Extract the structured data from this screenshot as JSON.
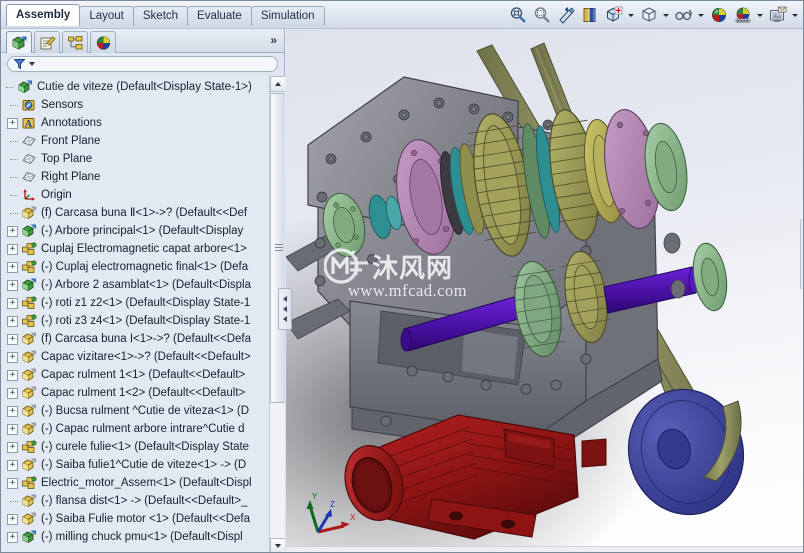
{
  "app": {
    "title": "SolidWorks Assembly",
    "accent": "#2c5d9b"
  },
  "command_manager": {
    "tabs": [
      {
        "label": "Assembly",
        "active": true
      },
      {
        "label": "Layout",
        "active": false
      },
      {
        "label": "Sketch",
        "active": false
      },
      {
        "label": "Evaluate",
        "active": false
      },
      {
        "label": "Simulation",
        "active": false
      }
    ],
    "tools": [
      {
        "name": "zoom-to-fit-icon",
        "dropdown": false
      },
      {
        "name": "zoom-to-area-icon",
        "dropdown": false
      },
      {
        "name": "previous-view-icon",
        "dropdown": false
      },
      {
        "name": "section-view-icon",
        "dropdown": false
      },
      {
        "name": "view-orientation-icon",
        "dropdown": true
      },
      {
        "name": "display-style-icon",
        "dropdown": true
      },
      {
        "name": "hide-show-items-icon",
        "dropdown": true
      },
      {
        "name": "edit-appearance-icon",
        "dropdown": false
      },
      {
        "name": "apply-scene-icon",
        "dropdown": true
      },
      {
        "name": "view-settings-icon",
        "dropdown": true
      }
    ]
  },
  "feature_manager": {
    "tabs": [
      {
        "name": "feature-tree-tab",
        "active": true
      },
      {
        "name": "property-manager-tab",
        "active": false
      },
      {
        "name": "configuration-manager-tab",
        "active": false
      },
      {
        "name": "display-manager-tab",
        "active": false
      }
    ],
    "overflow_label": "»",
    "filter": {
      "placeholder": "",
      "value": "",
      "icon": "filter-icon"
    },
    "tree": [
      {
        "label": "Cutie de viteze  (Default<Display State-1>)",
        "icon": "assembly-icon",
        "depth": 0,
        "expander": "none",
        "root": true
      },
      {
        "label": "Sensors",
        "icon": "sensors-folder-icon",
        "depth": 1,
        "expander": "none"
      },
      {
        "label": "Annotations",
        "icon": "annotations-folder-icon",
        "depth": 1,
        "expander": "plus"
      },
      {
        "label": "Front Plane",
        "icon": "plane-icon",
        "depth": 1,
        "expander": "none"
      },
      {
        "label": "Top Plane",
        "icon": "plane-icon",
        "depth": 1,
        "expander": "none"
      },
      {
        "label": "Right Plane",
        "icon": "plane-icon",
        "depth": 1,
        "expander": "none"
      },
      {
        "label": "Origin",
        "icon": "origin-icon",
        "depth": 1,
        "expander": "none"
      },
      {
        "label": "(f) Carcasa buna Ⅱ<1>->? (Default<<Def",
        "icon": "part-icon",
        "depth": 1,
        "expander": "none"
      },
      {
        "label": "(-) Arbore principal<1>  (Default<Display",
        "icon": "assembly-icon",
        "depth": 1,
        "expander": "plus"
      },
      {
        "label": "Cuplaj Electromagnetic capat arbore<1>",
        "icon": "subassembly-icon",
        "depth": 1,
        "expander": "plus"
      },
      {
        "label": "(-) Cuplaj electromagnetic final<1>  (Defa",
        "icon": "subassembly-icon",
        "depth": 1,
        "expander": "plus"
      },
      {
        "label": "(-) Arbore 2 asamblat<1>  (Default<Displa",
        "icon": "assembly-icon",
        "depth": 1,
        "expander": "plus"
      },
      {
        "label": "(-) roti z1 z2<1>  (Default<Display State-1",
        "icon": "subassembly-icon",
        "depth": 1,
        "expander": "plus"
      },
      {
        "label": "(-) roti z3 z4<1>  (Default<Display State-1",
        "icon": "subassembly-icon",
        "depth": 1,
        "expander": "plus"
      },
      {
        "label": "(f) Carcasa buna I<1>->? (Default<<Defa",
        "icon": "part-icon",
        "depth": 1,
        "expander": "plus"
      },
      {
        "label": "Capac vizitare<1>->? (Default<<Default>",
        "icon": "part-icon",
        "depth": 1,
        "expander": "plus"
      },
      {
        "label": "Capac rulment 1<1>  (Default<<Default>",
        "icon": "part-icon",
        "depth": 1,
        "expander": "plus"
      },
      {
        "label": "Capac rulment 1<2>  (Default<<Default>",
        "icon": "part-icon",
        "depth": 1,
        "expander": "plus"
      },
      {
        "label": "(-) Bucsa rulment ^Cutie de viteza<1>  (D",
        "icon": "part-icon",
        "depth": 1,
        "expander": "plus"
      },
      {
        "label": "(-) Capac rulment arbore intrare^Cutie d",
        "icon": "part-icon",
        "depth": 1,
        "expander": "plus"
      },
      {
        "label": "(-) curele fulie<1>  (Default<Display State",
        "icon": "subassembly-icon",
        "depth": 1,
        "expander": "plus"
      },
      {
        "label": "(-) Saiba fulie1^Cutie de viteze<1> -> (D",
        "icon": "part-icon",
        "depth": 1,
        "expander": "plus"
      },
      {
        "label": "Electric_motor_Assem<1>  (Default<Displ",
        "icon": "subassembly-icon",
        "depth": 1,
        "expander": "plus"
      },
      {
        "label": "(-) flansa dist<1> -> (Default<<Default>_",
        "icon": "part-icon",
        "depth": 1,
        "expander": "none"
      },
      {
        "label": "(-) Saiba Fulie motor <1>  (Default<<Defa",
        "icon": "part-icon",
        "depth": 1,
        "expander": "plus"
      },
      {
        "label": "(-) milling chuck pmu<1>  (Default<Displ",
        "icon": "assembly-icon",
        "depth": 1,
        "expander": "plus"
      }
    ],
    "scrollbar": {
      "name": "feature-tree-scrollbar"
    }
  },
  "viewport": {
    "name": "3d-viewport",
    "watermark": {
      "brand": "MF",
      "chinese": "沐风网",
      "url": "www.mfcad.com"
    },
    "triad": {
      "x_label": "X",
      "y_label": "Y",
      "z_label": "Z",
      "x_color": "#b01818",
      "y_color": "#0d6b1f",
      "z_color": "#1d33b5"
    },
    "model_colors": {
      "housing_gray": "#80818a",
      "housing_dark": "#5e6068",
      "gear_olive": "#9b9a55",
      "gear_green": "#7fa882",
      "flange_pink": "#b58cb5",
      "flange_green": "#8fb58f",
      "shaft_purple": "#4b12a8",
      "belt_olive": "#878a56",
      "pulley_blue": "#3a3f9c",
      "motor_red": "#9c1515",
      "teal_ring": "#2e8f92"
    }
  }
}
